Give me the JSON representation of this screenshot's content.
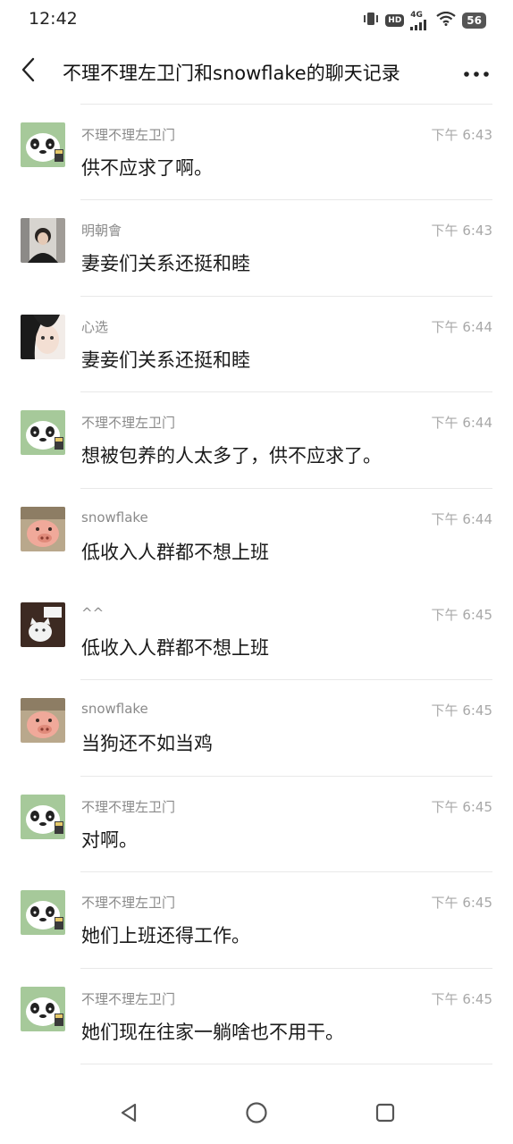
{
  "status_bar": {
    "time": "12:42",
    "hd": "HD",
    "network": "4G",
    "battery": "56"
  },
  "header": {
    "title": "不理不理左卫门和snowflake的聊天记录",
    "back_icon": "chevron-left-icon",
    "more_icon": "more-dots-icon"
  },
  "messages": [
    {
      "sender": "不理不理左卫门",
      "time": "下午 6:43",
      "text": "供不应求了啊。",
      "avatar": "panda"
    },
    {
      "sender": "明朝會",
      "time": "下午 6:43",
      "text": "妻妾们关系还挺和睦",
      "avatar": "person"
    },
    {
      "sender": "心选",
      "time": "下午 6:44",
      "text": "妻妾们关系还挺和睦",
      "avatar": "girl"
    },
    {
      "sender": "不理不理左卫门",
      "time": "下午 6:44",
      "text": "想被包养的人太多了，供不应求了。",
      "avatar": "panda"
    },
    {
      "sender": "snowflake",
      "time": "下午 6:44",
      "text": "低收入人群都不想上班",
      "avatar": "pig"
    },
    {
      "sender": "^^",
      "time": "下午 6:45",
      "text": "低收入人群都不想上班",
      "avatar": "cat"
    },
    {
      "sender": "snowflake",
      "time": "下午 6:45",
      "text": "当狗还不如当鸡",
      "avatar": "pig"
    },
    {
      "sender": "不理不理左卫门",
      "time": "下午 6:45",
      "text": "对啊。",
      "avatar": "panda"
    },
    {
      "sender": "不理不理左卫门",
      "time": "下午 6:45",
      "text": "她们上班还得工作。",
      "avatar": "panda"
    },
    {
      "sender": "不理不理左卫门",
      "time": "下午 6:45",
      "text": "她们现在往家一躺啥也不用干。",
      "avatar": "panda"
    }
  ],
  "system_nav": {
    "back_icon": "triangle-back-icon",
    "home_icon": "circle-home-icon",
    "recents_icon": "square-recents-icon"
  }
}
